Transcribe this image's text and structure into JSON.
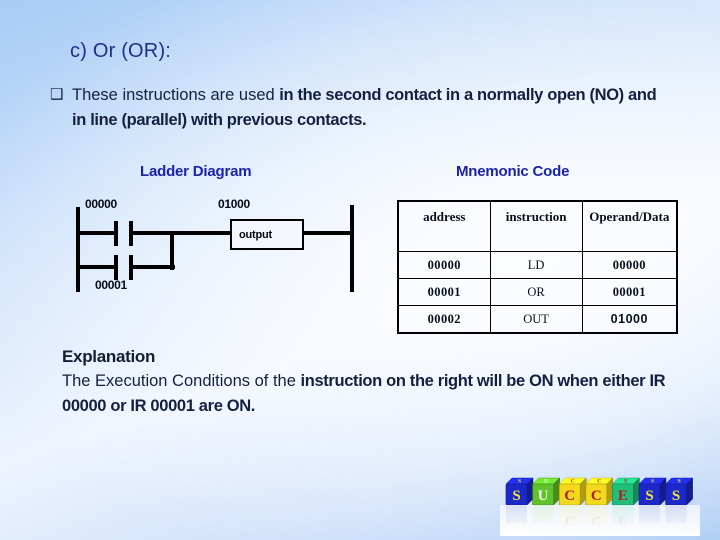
{
  "slide": {
    "subtitle": "c) Or (OR):",
    "bullet_marker": "❑",
    "bullet": {
      "regular": "These instructions are used ",
      "bold": "in the second contact in a normally open (NO) and in line (parallel) with previous contacts."
    }
  },
  "ladder": {
    "heading": "Ladder Diagram",
    "contact_top_label": "00000",
    "contact_bottom_label": "00001",
    "output_label": "01000",
    "output_box_text": "output"
  },
  "mnemonic": {
    "heading": "Mnemonic Code",
    "headers": [
      "address",
      "instruction",
      "Operand/Data"
    ],
    "rows": [
      [
        "00000",
        "LD",
        "00000"
      ],
      [
        "00001",
        "OR",
        "00001"
      ],
      [
        "00002",
        "OUT",
        "01000"
      ]
    ]
  },
  "explanation": {
    "title": "Explanation",
    "regular": "The Execution Conditions of the ",
    "bold": "instruction on the right will be ON when either IR 00000 or IR 00001 are ON."
  },
  "logo": {
    "word": "SUCCESS",
    "letters": [
      {
        "char": "S",
        "cube": "#1c28c8",
        "text": "#f2e63a"
      },
      {
        "char": "U",
        "cube": "#5fc32a",
        "text": "#fbfbe8"
      },
      {
        "char": "C",
        "cube": "#f2d91b",
        "text": "#b01a2e"
      },
      {
        "char": "C",
        "cube": "#f2d91b",
        "text": "#b01a2e"
      },
      {
        "char": "E",
        "cube": "#1fbf7a",
        "text": "#c01526"
      },
      {
        "char": "S",
        "cube": "#1c28c8",
        "text": "#f2e63a"
      },
      {
        "char": "S",
        "cube": "#1c28c8",
        "text": "#f2e63a"
      }
    ]
  },
  "colors": {
    "heading_blue": "#1a23a8",
    "subtitle_blue": "#1f2f86",
    "body_dark": "#14203f",
    "line_black": "#000000",
    "bg_top": "#a8cbf5",
    "bg_mid": "#eef4fe",
    "bg_bottom": "#a9caf3"
  }
}
